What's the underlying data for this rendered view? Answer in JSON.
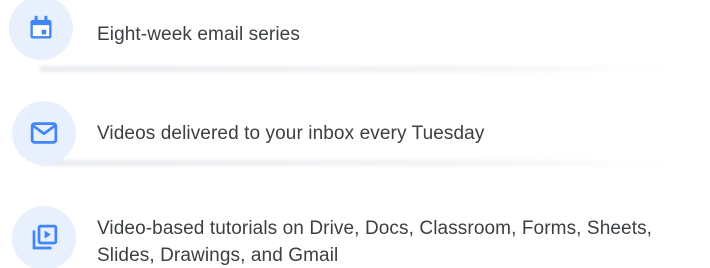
{
  "features": [
    {
      "icon": "calendar-icon",
      "text": "Eight-week email series"
    },
    {
      "icon": "mail-icon",
      "text": "Videos delivered to your inbox every Tuesday"
    },
    {
      "icon": "video-library-icon",
      "text": "Video-based tutorials on Drive, Docs, Classroom, Forms, Sheets, Slides, Drawings, and Gmail"
    }
  ],
  "colors": {
    "icon_blue": "#4285f4",
    "icon_bg": "#e8f0fe",
    "text": "#3c4043"
  }
}
